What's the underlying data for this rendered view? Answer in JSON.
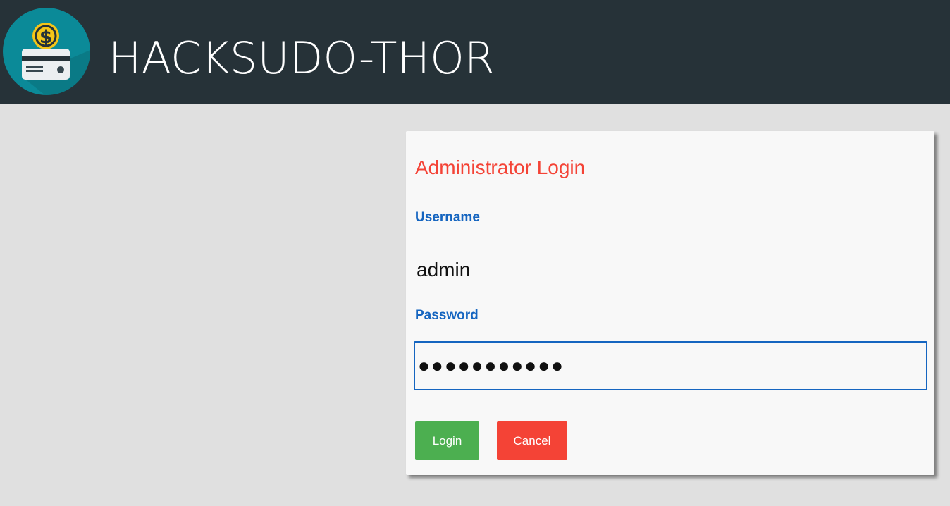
{
  "header": {
    "title": "HACKSUDO-THOR",
    "logo_icon": "money-card-icon",
    "background_color": "#263238"
  },
  "login": {
    "title": "Administrator Login",
    "username_label": "Username",
    "username_value": "admin",
    "password_label": "Password",
    "password_value": "●●●●●●●●●●●",
    "login_label": "Login",
    "cancel_label": "Cancel",
    "colors": {
      "title": "#f44336",
      "labels": "#1565c0",
      "login_button": "#4caf50",
      "cancel_button": "#f44336"
    }
  }
}
